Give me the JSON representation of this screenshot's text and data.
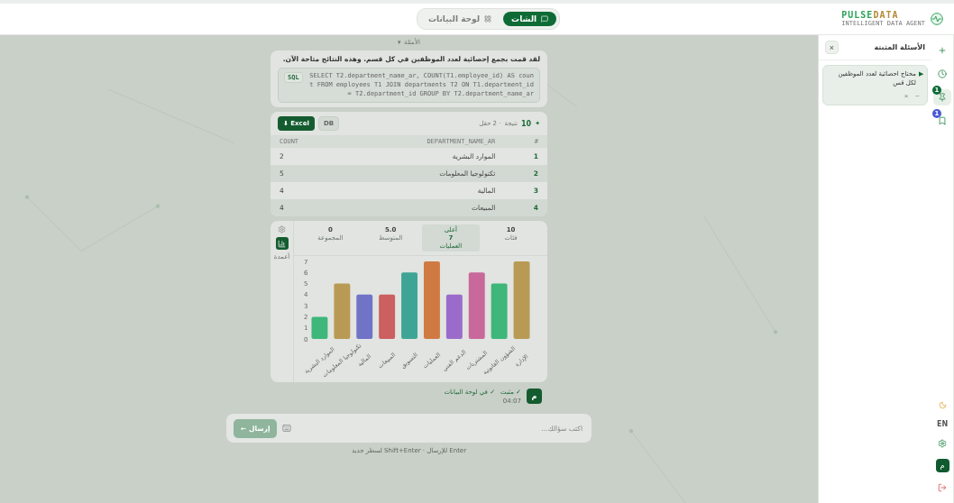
{
  "brand": {
    "name_a": "PULSE",
    "name_b": "DATA",
    "tagline": "INTELLIGENT DATA AGENT"
  },
  "view_tabs": [
    {
      "label": "الشات",
      "selected": true
    },
    {
      "label": "لوحة البيانات",
      "selected": false
    }
  ],
  "examples_toggle": {
    "caret": "▾",
    "label": "الأمثلة"
  },
  "message": {
    "text": "لقد قمت بجمع إحصائية لعدد الموظفين في كل قسم. وهذه النتائج متاحة الآن.",
    "sql_badge": "SQL",
    "sql": "SELECT T2.department_name_ar, COUNT(T1.employee_id) AS count FROM employees T1 JOIN departments T2 ON T1.department_id = T2.department_id GROUP BY T2.department_name_ar"
  },
  "results": {
    "mark": "✦",
    "count": "10",
    "count_label": "نتيجة",
    "fields": "· 2 حقل",
    "buttons": [
      {
        "label": "DB",
        "kind": "secondary"
      },
      {
        "label": "Excel ⬇",
        "kind": "primary"
      }
    ],
    "columns": [
      "#",
      "DEPARTMENT_NAME_AR",
      "COUNT"
    ],
    "rows": [
      [
        "1",
        "الموارد البشرية",
        "2"
      ],
      [
        "2",
        "تكنولوجيا المعلومات",
        "5"
      ],
      [
        "3",
        "المالية",
        "4"
      ],
      [
        "4",
        "المبيعات",
        "4"
      ]
    ]
  },
  "stats": [
    {
      "value": "10",
      "label": "فئات",
      "selected": false
    },
    {
      "top": "أعلى",
      "value": "7",
      "label": "العمليات",
      "selected": true
    },
    {
      "value": "5.0",
      "label": "المتوسط",
      "selected": false
    },
    {
      "value": "0",
      "label": "المجموعة",
      "selected": false
    }
  ],
  "chart_type": {
    "label": "أعمدة",
    "selected": true
  },
  "chart": {
    "chart_data": {
      "type": "bar",
      "categories": [
        "الموارد البشرية",
        "تكنولوجيا المعلومات",
        "المالية",
        "المبيعات",
        "التسويق",
        "العمليات",
        "الدعم الفني",
        "المشتريات",
        "الشؤون القانونية",
        "الإدارة"
      ],
      "values": [
        2,
        5,
        4,
        4,
        6,
        7,
        4,
        6,
        5,
        7
      ],
      "ylim": [
        0,
        7
      ],
      "yticks": [
        0,
        1,
        2,
        3,
        4,
        5,
        6,
        7
      ]
    }
  },
  "message_meta": {
    "pinned": "✓ مثبت",
    "on_dashboard": "✓ في لوحة البيانات",
    "time": "04:07",
    "avatar": "م"
  },
  "input": {
    "placeholder": "اكتب سؤالك...",
    "send": "إرسال ←",
    "hint": "Enter للإرسال · Shift+Enter لسطر جديد"
  },
  "pinned_panel": {
    "title": "الأسئلة المثبتة",
    "close": "×",
    "items": [
      {
        "text": "محتاج احصائية لعدد الموظفين لكل قس",
        "run": "▶",
        "collapse": "−",
        "remove": "×"
      }
    ]
  },
  "rail": {
    "top": [
      {
        "selected": false
      },
      {
        "selected": false
      },
      {
        "selected": true,
        "badge": "1",
        "color": "#0f6b35"
      },
      {
        "selected": false,
        "badge": "1",
        "color": "#4a5bd6"
      }
    ],
    "lang": "EN",
    "avatar": "م"
  }
}
